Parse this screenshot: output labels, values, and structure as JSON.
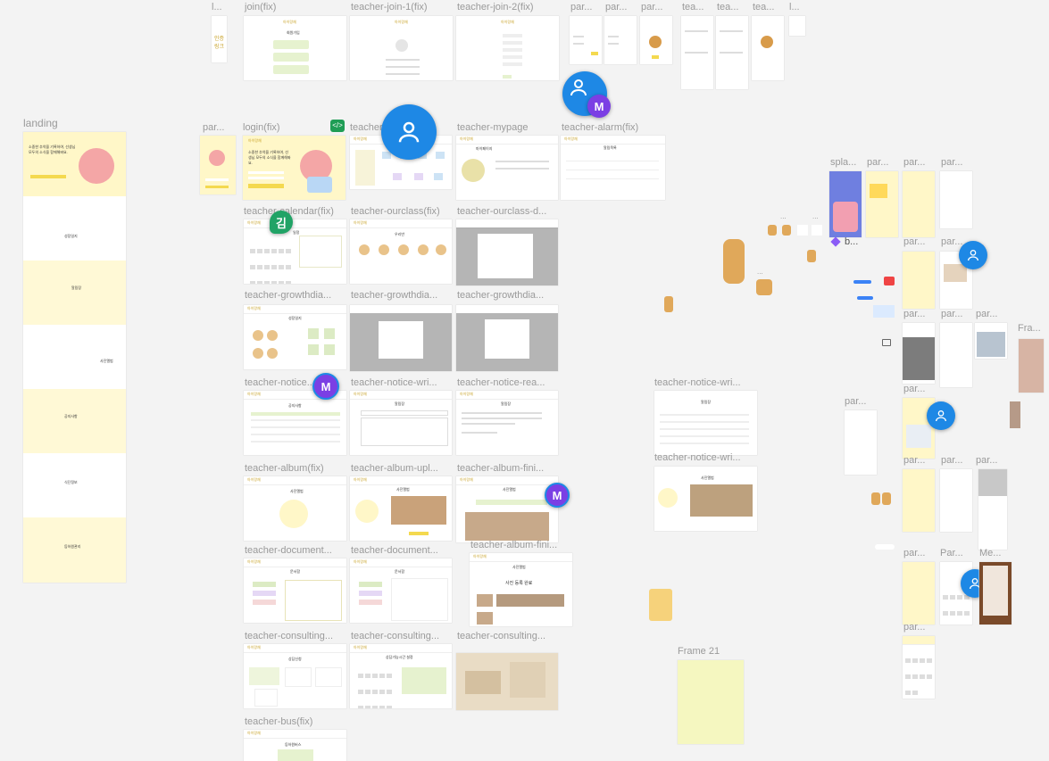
{
  "canvas": {
    "background": "#f3f3f3",
    "accent": "#fff7c8",
    "avatar_blue": "#1e88e5",
    "avatar_purple": "#7b3fe4",
    "avatar_green": "#21a366"
  },
  "frame_labels": {
    "l": "l...",
    "join": "join(fix)",
    "teacher_join_1": "teacher-join-1(fix)",
    "teacher_join_2": "teacher-join-2(fix)",
    "par1": "par...",
    "par2": "par...",
    "par3": "par...",
    "tea1": "tea...",
    "tea2": "tea...",
    "tea3": "tea...",
    "tea4": "tea...",
    "l2": "l...",
    "landing": "landing",
    "par_login": "par...",
    "login": "login(fix)",
    "teacher_main": "teacher",
    "teacher_mypage": "teacher-mypage",
    "teacher_alarm": "teacher-alarm(fix)",
    "teacher_calendar": "teacher-calendar(fix)",
    "teacher_ourclass": "teacher-ourclass(fix)",
    "teacher_ourclass_d": "teacher-ourclass-d...",
    "teacher_growth1": "teacher-growthdia...",
    "teacher_growth2": "teacher-growthdia...",
    "teacher_growth3": "teacher-growthdia...",
    "teacher_notice": "teacher-notice...",
    "teacher_notice_wri": "teacher-notice-wri...",
    "teacher_notice_rea": "teacher-notice-rea...",
    "teacher_notice_wri2": "teacher-notice-wri...",
    "teacher_notice_wri3": "teacher-notice-wri...",
    "teacher_album": "teacher-album(fix)",
    "teacher_album_upl": "teacher-album-upl...",
    "teacher_album_fini": "teacher-album-fini...",
    "teacher_album_fini2": "teacher-album-fini...",
    "teacher_document1": "teacher-document...",
    "teacher_document2": "teacher-document...",
    "teacher_consulting1": "teacher-consulting...",
    "teacher_consulting2": "teacher-consulting...",
    "teacher_consulting3": "teacher-consulting...",
    "teacher_bus": "teacher-bus(fix)",
    "frame21": "Frame 21",
    "spla": "spla...",
    "par_r1": "par...",
    "par_r2": "par...",
    "par_r3": "par...",
    "par_r4": "par...",
    "par_r5": "par...",
    "par_r6": "par...",
    "par_r7": "par...",
    "par_r8": "par...",
    "par_r9": "par...",
    "par_r10": "par...",
    "par_r11": "par...",
    "par_r12": "par...",
    "par_r13": "par...",
    "par_r14": "par...",
    "par_r15": "Par...",
    "me": "Me...",
    "fra": "Fra...",
    "b_comp": "b...",
    "dots1": "...",
    "dots2": "...",
    "dots3": "..."
  },
  "frame_texts": {
    "app_logo": "아이랑채",
    "login_tagline": "소중한 추억을 기록하여, 선생님 모두의 소식을 함께해봐요.",
    "join_title": "회원가입",
    "teacher_join_title": "회원가입",
    "mypage_title": "마이페이지",
    "alarm_title": "알림목록",
    "calendar_title": "일정",
    "ourclass_title": "우리반",
    "growth_title": "성장일지",
    "notice_title": "공지사항",
    "notice_write_title": "알림장",
    "notice_read_title": "알림장",
    "album_title": "사진앨범",
    "album_done": "사진 등록 완료",
    "document_title": "문서함",
    "consulting_title": "상담신청",
    "consulting_time": "상담가능시간 설정",
    "bus_title": "등하원버스",
    "landing_sections": [
      "성장일지",
      "알림장",
      "사진앨범",
      "공지사항",
      "식단정보",
      "등하원관리"
    ]
  },
  "avatars": {
    "kim": "김",
    "m1": "M",
    "m2": "M",
    "m3": "M"
  }
}
